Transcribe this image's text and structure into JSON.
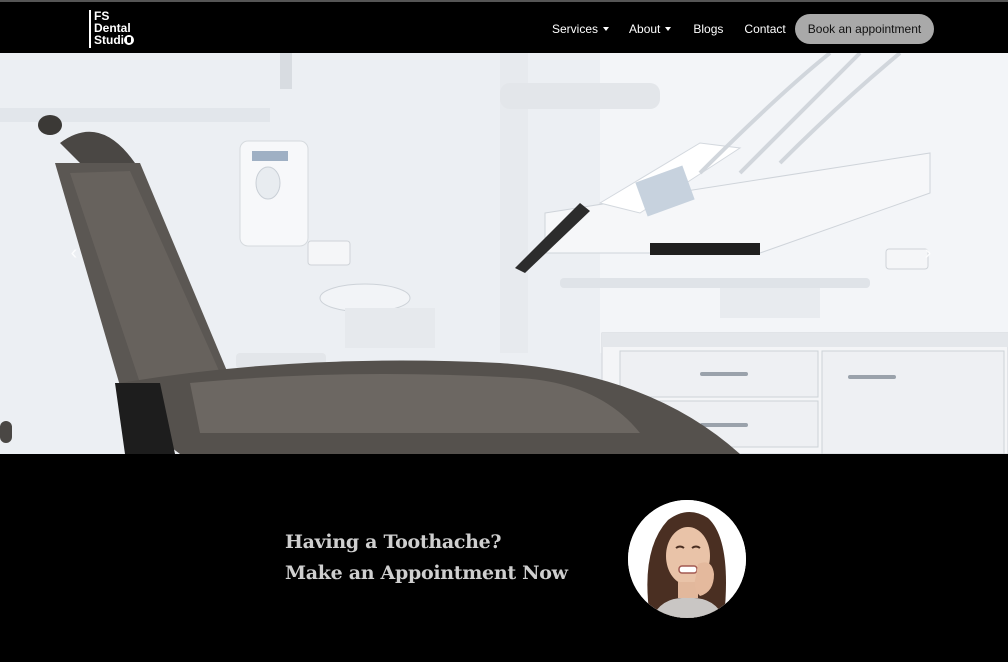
{
  "brand": {
    "line1": "FS",
    "line2": "Dental",
    "line3": "Studi"
  },
  "nav": {
    "services": "Services",
    "about": "About",
    "blogs": "Blogs",
    "contact": "Contact",
    "book_button": "Book an appointment"
  },
  "hero": {
    "image": "dental-chair-clinic-photo",
    "prev_icon": "‹",
    "next_icon": "›"
  },
  "cta": {
    "line1": "Having a Toothache?",
    "line2": "Make an Appointment Now",
    "photo": "woman-with-toothache-photo"
  }
}
